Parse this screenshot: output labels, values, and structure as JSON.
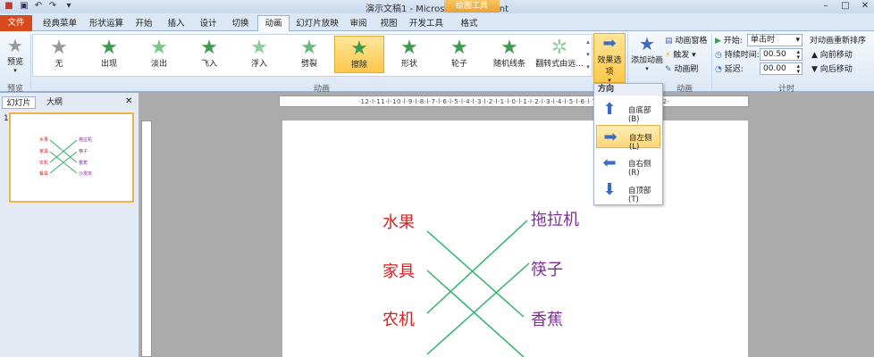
{
  "window": {
    "title": "演示文稿1 - Microsoft PowerPoint",
    "context_tab": "绘图工具",
    "qat_icons": [
      "save-icon",
      "undo-icon",
      "redo-icon",
      "customize-icon"
    ]
  },
  "tabs": [
    {
      "label": "文件"
    },
    {
      "label": "经典菜单"
    },
    {
      "label": "形状运算"
    },
    {
      "label": "开始"
    },
    {
      "label": "插入"
    },
    {
      "label": "设计"
    },
    {
      "label": "切换"
    },
    {
      "label": "动画"
    },
    {
      "label": "幻灯片放映"
    },
    {
      "label": "审阅"
    },
    {
      "label": "视图"
    },
    {
      "label": "开发工具"
    },
    {
      "label": "格式"
    }
  ],
  "ribbon": {
    "preview": {
      "label": "预览",
      "group": "预览"
    },
    "animations": [
      {
        "label": "无"
      },
      {
        "label": "出现"
      },
      {
        "label": "淡出"
      },
      {
        "label": "飞入"
      },
      {
        "label": "浮入"
      },
      {
        "label": "劈裂"
      },
      {
        "label": "擦除"
      },
      {
        "label": "形状"
      },
      {
        "label": "轮子"
      },
      {
        "label": "随机线条"
      },
      {
        "label": "翻转式由远..."
      }
    ],
    "animation_group": "动画",
    "effect_options": "效果选项",
    "add_animation": "添加动画",
    "animation_pane": "动画窗格",
    "trigger": "触发",
    "animation_painter": "动画刷",
    "advanced_group": "高级动画",
    "advanced_group_visible": "动画",
    "start_label": "开始:",
    "start_value": "单击时",
    "duration_label": "持续时间:",
    "duration_value": "00.50",
    "delay_label": "延迟:",
    "delay_value": "00.00",
    "timing_group": "计时",
    "reorder_label": "对动画重新排序",
    "move_earlier": "向前移动",
    "move_later": "向后移动"
  },
  "left_pane": {
    "tab_slides": "幻灯片",
    "tab_outline": "大纲",
    "slide_number": "1"
  },
  "ruler_text": "·12·l·11·l·10·l·9·l·8·l·7·l·6·l·5·l·4·l·3·l·2·l·1·l·0·l·1·l·2·l·3·l·4·l·5·l·6·l·7·l·8·l·9·l·10·l·11·l·12·",
  "slide": {
    "left_words": [
      "水果",
      "家具",
      "农机"
    ],
    "right_words": [
      "拖拉机",
      "筷子",
      "香蕉"
    ],
    "thumb_left": [
      "水果",
      "家具",
      "农机",
      "餐具"
    ],
    "thumb_right": [
      "拖拉机",
      "筷子",
      "香蕉",
      "沙发床"
    ]
  },
  "direction_menu": {
    "header": "方向",
    "items": [
      {
        "label": "自底部(B)",
        "icon": "arrow-up-icon"
      },
      {
        "label": "自左侧(L)",
        "icon": "arrow-right-icon"
      },
      {
        "label": "自右侧(R)",
        "icon": "arrow-left-icon"
      },
      {
        "label": "自顶部(T)",
        "icon": "arrow-down-icon"
      }
    ]
  },
  "colors": {
    "accent_orange": "#D84A1B",
    "word_red": "#D42020",
    "word_purple": "#7A2E93",
    "line_green": "#2DB36B",
    "selection": "#FFC84A"
  }
}
